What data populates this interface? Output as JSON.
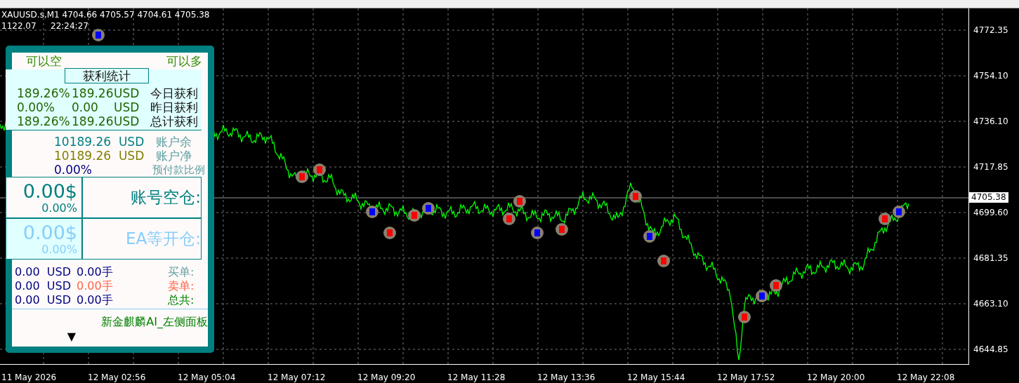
{
  "chart": {
    "symbol_line": "XAUUSD.s,M1  4704.66 4705.57 4704.61 4705.38",
    "info": [
      "1122.07",
      "22:24:27"
    ],
    "price_labels": [
      "4772.35",
      "4754.10",
      "4736.10",
      "4717.85",
      "4699.60",
      "4681.35",
      "4663.10",
      "4644.85"
    ],
    "current_price": "4705.38",
    "time_labels": [
      "11 May 2026",
      "12 May 02:56",
      "12 May 05:04",
      "12 May 07:12",
      "12 May 09:20",
      "12 May 11:28",
      "12 May 13:36",
      "12 May 15:44",
      "12 May 17:52",
      "12 May 20:00",
      "12 May 22:08"
    ]
  },
  "panel": {
    "sell_signal": "可以空",
    "buy_signal": "可以多",
    "stats_title": "获利统计",
    "profit_rows": [
      {
        "percent": "189.26%",
        "amount": "189.26",
        "currency": "USD",
        "label": "今日获利"
      },
      {
        "percent": "0.00%",
        "amount": "0.00",
        "currency": "USD",
        "label": "昨日获利"
      },
      {
        "percent": "189.26%",
        "amount": "189.26",
        "currency": "USD",
        "label": "总计获利"
      }
    ],
    "account_rows": [
      {
        "kind": "balance",
        "amount": "10189.26",
        "currency": "USD",
        "label": "账户余"
      },
      {
        "kind": "equity",
        "amount": "10189.26",
        "currency": "USD",
        "label": "账户净"
      }
    ],
    "margin": {
      "value": "0.00%",
      "label": "预付款比例"
    },
    "status_boxes": [
      {
        "kind": "account",
        "amount": "0.00$",
        "percent": "0.00%",
        "label": "账号空仓:"
      },
      {
        "kind": "ea",
        "amount": "0.00$",
        "percent": "0.00%",
        "label": "EA等开仓:"
      }
    ],
    "order_rows": [
      {
        "kind": "buy",
        "amount": "0.00",
        "currency": "USD",
        "lots": "0.00手",
        "label": "买单:"
      },
      {
        "kind": "sell",
        "amount": "0.00",
        "currency": "USD",
        "lots": "0.00手",
        "label": "卖单:"
      },
      {
        "kind": "total",
        "amount": "0.00",
        "currency": "USD",
        "lots": "0.00手",
        "label": "总共:"
      }
    ],
    "footer": "新金麒麟AI_左侧面板",
    "toggle": "▼"
  }
}
